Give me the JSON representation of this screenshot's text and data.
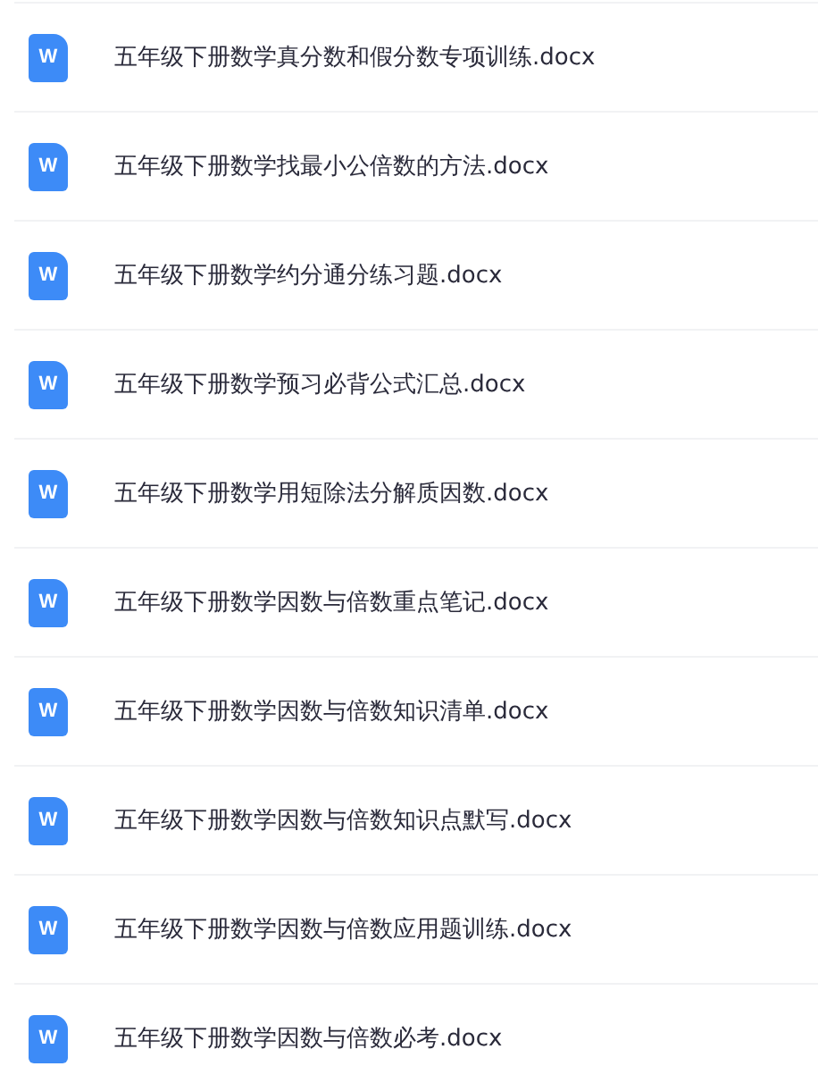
{
  "files": [
    {
      "name": "五年级下册数学真分数和假分数专项训练.docx",
      "icon_letter": "W"
    },
    {
      "name": "五年级下册数学找最小公倍数的方法.docx",
      "icon_letter": "W"
    },
    {
      "name": "五年级下册数学约分通分练习题.docx",
      "icon_letter": "W"
    },
    {
      "name": "五年级下册数学预习必背公式汇总.docx",
      "icon_letter": "W"
    },
    {
      "name": "五年级下册数学用短除法分解质因数.docx",
      "icon_letter": "W"
    },
    {
      "name": "五年级下册数学因数与倍数重点笔记.docx",
      "icon_letter": "W"
    },
    {
      "name": "五年级下册数学因数与倍数知识清单.docx",
      "icon_letter": "W"
    },
    {
      "name": "五年级下册数学因数与倍数知识点默写.docx",
      "icon_letter": "W"
    },
    {
      "name": "五年级下册数学因数与倍数应用题训练.docx",
      "icon_letter": "W"
    },
    {
      "name": "五年级下册数学因数与倍数必考.docx",
      "icon_letter": "W"
    }
  ]
}
